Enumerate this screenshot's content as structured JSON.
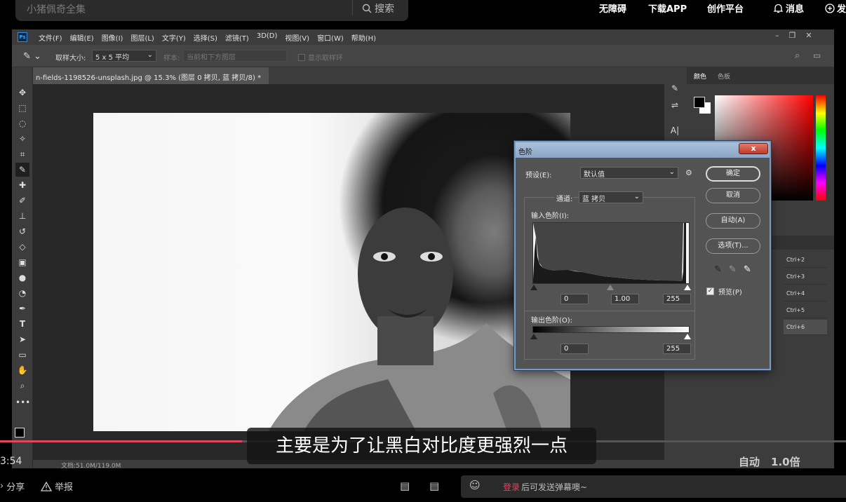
{
  "site": {
    "search_placeholder": "小猪佩奇全集",
    "search_button": "搜索",
    "links": [
      "无障碍",
      "下载APP",
      "创作平台",
      "消息",
      "发"
    ]
  },
  "ps": {
    "logo": "Ps",
    "menus": [
      "文件(F)",
      "编辑(E)",
      "图像(I)",
      "图层(L)",
      "文字(Y)",
      "选择(S)",
      "滤镜(T)",
      "3D(D)",
      "视图(V)",
      "窗口(W)",
      "帮助(H)"
    ],
    "options": {
      "size_label": "取样大小:",
      "size_value": "5 x 5 平均",
      "sample_label": "样本:",
      "sample_value": "当前和下方图层",
      "ring_label": "显示取样环"
    },
    "doc_tab": "n-fields-1198526-unsplash.jpg @ 15.3% (图层 0 拷贝, 蓝 拷贝/8) *",
    "doc_close": "×",
    "status": "文档:51.0M/119.0M",
    "panel_tabs": [
      "颜色",
      "色板"
    ],
    "shortcuts": [
      "Ctrl+2",
      "Ctrl+3",
      "Ctrl+4",
      "Ctrl+5",
      "Ctrl+6"
    ]
  },
  "levels": {
    "title": "色阶",
    "close": "x",
    "preset_label": "预设(E):",
    "preset_value": "默认值",
    "channel_label": "通道:",
    "channel_value": "蓝 拷贝",
    "input_label": "输入色阶(I):",
    "input_black": "0",
    "input_gamma": "1.00",
    "input_white": "255",
    "output_label": "输出色阶(O):",
    "output_black": "0",
    "output_white": "255",
    "buttons": {
      "ok": "确定",
      "cancel": "取消",
      "auto": "自动(A)",
      "options": "选项(T)..."
    },
    "preview_label": "预览(P)",
    "preview_checked": true
  },
  "player": {
    "subtitle": "主要是为了让黑白对比度更强烈一点",
    "time": "3:54",
    "progress": 0.286,
    "quality": "自动",
    "speed": "1.0倍",
    "share": "分享",
    "report": "举报",
    "danmaku_login": "登录",
    "danmaku_hint": "后可发送弹幕噢~"
  }
}
